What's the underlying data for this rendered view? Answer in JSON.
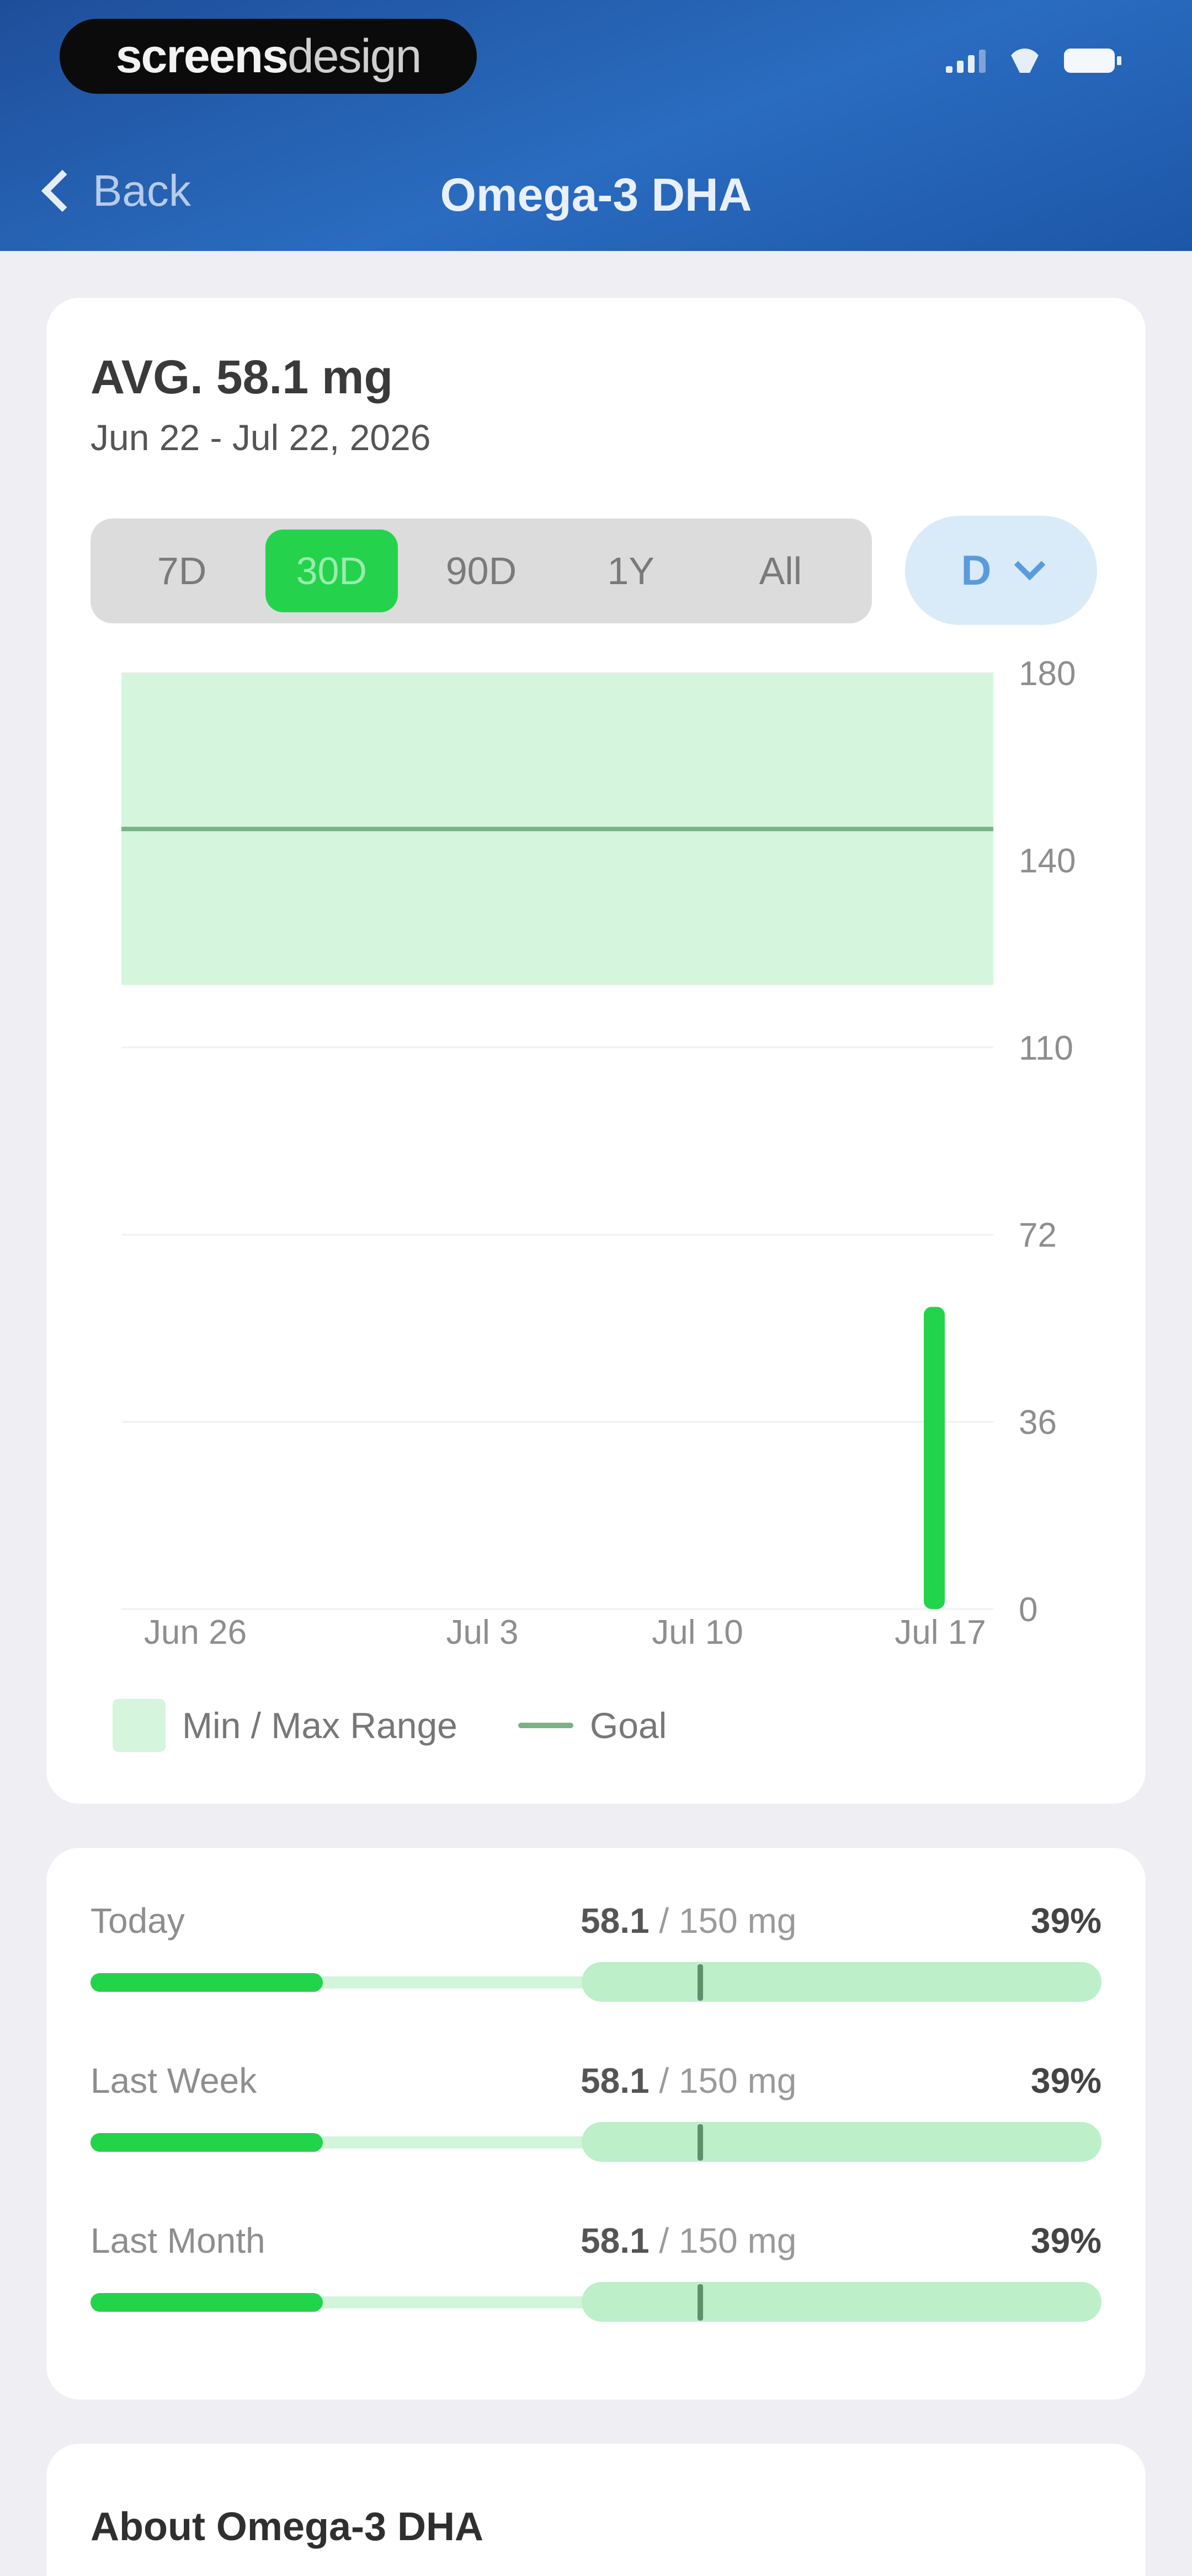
{
  "brand": {
    "bold": "screens",
    "light": "design"
  },
  "nav": {
    "back_label": "Back",
    "title": "Omega-3 DHA"
  },
  "summary": {
    "avg": "AVG. 58.1 mg",
    "date_range": "Jun 22 - Jul 22, 2026"
  },
  "ranges": {
    "options": [
      "7D",
      "30D",
      "90D",
      "1Y",
      "All"
    ],
    "selected": "30D"
  },
  "unit": {
    "label": "D"
  },
  "chart_data": {
    "type": "bar",
    "y_ticks": [
      "180",
      "140",
      "110",
      "72",
      "36",
      "0"
    ],
    "x_ticks": [
      "Jun 26",
      "Jul 3",
      "Jul 10",
      "Jul 17"
    ],
    "ylim": [
      0,
      180
    ],
    "range_band": [
      120,
      180
    ],
    "goal": 150,
    "bars": [
      {
        "x": "Jul 22",
        "value": 58.1
      }
    ],
    "legend": [
      "Min / Max Range",
      "Goal"
    ],
    "colors": {
      "bar": "#22D44A",
      "band": "#D5F5DC",
      "goal": "#7AB386"
    }
  },
  "progress": [
    {
      "label": "Today",
      "value": "58.1",
      "target": " / 150 mg",
      "pct": "39%",
      "fraction": 0.39
    },
    {
      "label": "Last Week",
      "value": "58.1",
      "target": " / 150 mg",
      "pct": "39%",
      "fraction": 0.39
    },
    {
      "label": "Last Month",
      "value": "58.1",
      "target": " / 150 mg",
      "pct": "39%",
      "fraction": 0.39
    }
  ],
  "about": {
    "title": "About Omega-3 DHA"
  }
}
